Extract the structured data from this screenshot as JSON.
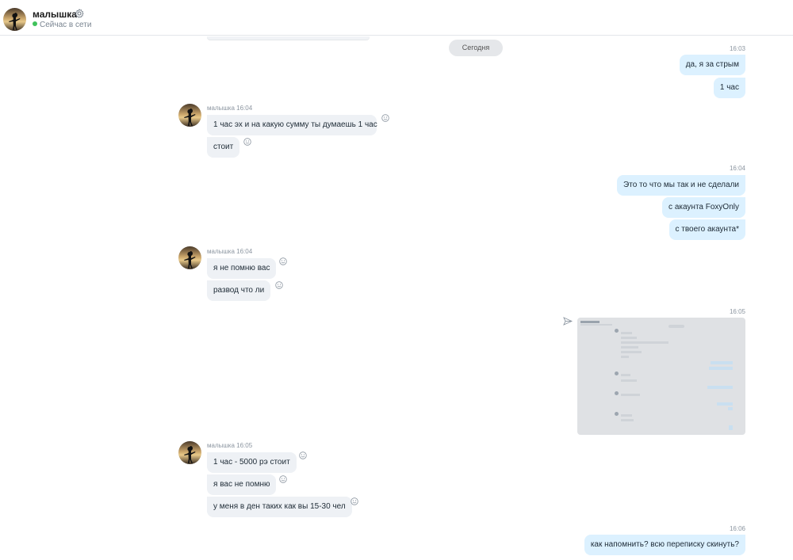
{
  "header": {
    "name": "малышка",
    "status": "Сейчас в сети"
  },
  "date_separator": "Сегодня",
  "messages": {
    "out1": {
      "time": "16:03",
      "bubbles": [
        "да, я за стрым",
        "1 час"
      ]
    },
    "in1": {
      "sender": "малышка",
      "time": "16:04",
      "bubbles": [
        "1 час эх и на какую сумму ты думаешь 1 час",
        "стоит"
      ]
    },
    "out2": {
      "time": "16:04",
      "bubbles": [
        "Это то что мы так и не сделали",
        "с акаунта FoxyOnly",
        "с твоего акаунта*"
      ]
    },
    "in2": {
      "sender": "малышка",
      "time": "16:04",
      "bubbles": [
        "я не помню вас",
        "развод что ли"
      ]
    },
    "out3": {
      "time": "16:05",
      "attachment": "screenshot-image"
    },
    "in3": {
      "sender": "малышка",
      "time": "16:05",
      "bubbles": [
        "1 час - 5000 рэ стоит",
        "я вас не помню",
        "у меня в ден таких как вы 15-30 чел"
      ]
    },
    "out4": {
      "time": "16:06",
      "bubbles": [
        "как напомнить? всю переписку скинуть?"
      ]
    }
  },
  "colors": {
    "outgoing_bubble": "#dcf1ff",
    "incoming_bubble": "#eef1f5",
    "online_dot": "#3fc25b",
    "date_pill": "#e5e7ea"
  },
  "icons": [
    "avatar",
    "gear-icon",
    "smiley-icon",
    "send-icon"
  ]
}
